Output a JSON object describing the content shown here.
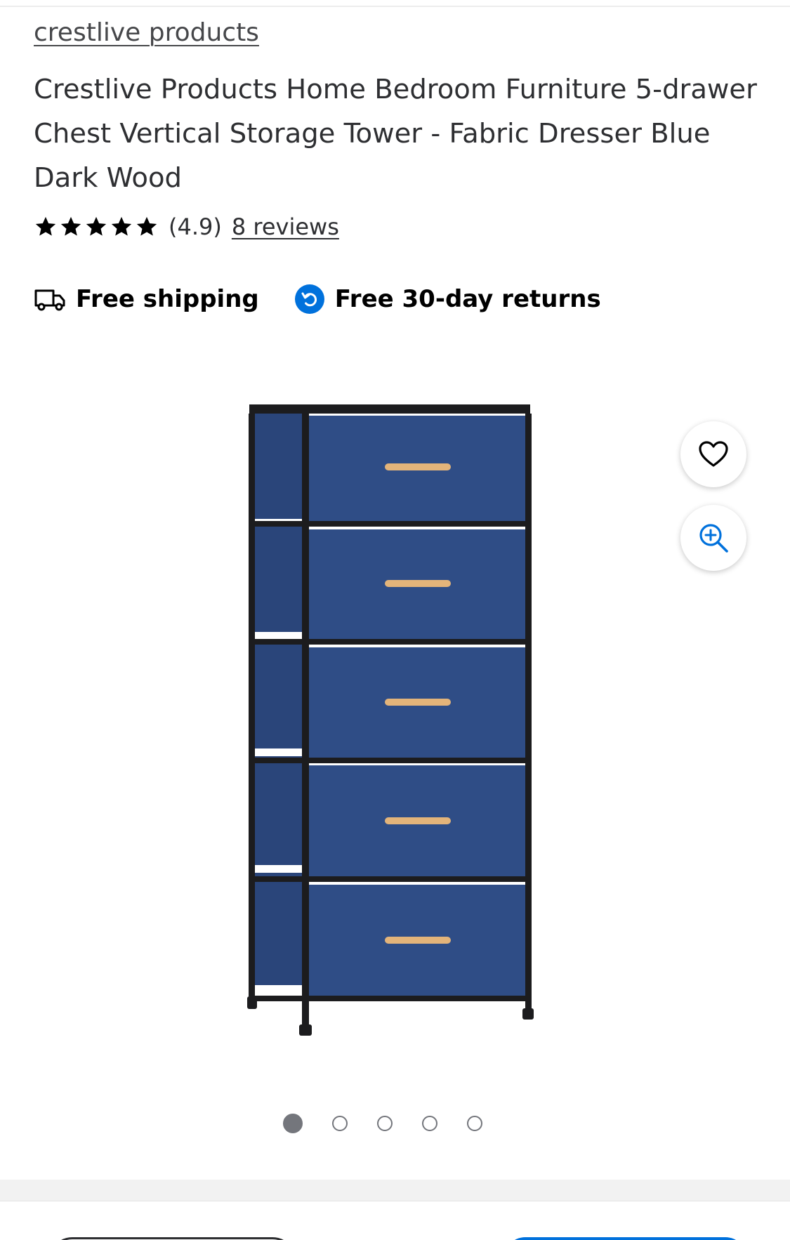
{
  "product": {
    "brand": "crestlive products",
    "title": "Crestlive Products Home Bedroom Furniture 5-drawer Chest Vertical Storage Tower - Fabric Dresser Blue Dark Wood",
    "rating_stars": 5,
    "rating_text": "(4.9)",
    "reviews_text": "8 reviews"
  },
  "badges": {
    "shipping": {
      "icon": "truck-icon",
      "label": "Free shipping"
    },
    "returns": {
      "icon": "returns-icon",
      "label": "Free 30-day returns",
      "color": "#0071dc"
    }
  },
  "image_actions": {
    "favorite_icon": "heart-icon",
    "zoom_icon": "zoom-in-icon",
    "zoom_color": "#0071dc"
  },
  "carousel": {
    "total": 5,
    "active_index": 0
  },
  "colors": {
    "text": "#2e2f32",
    "accent": "#0071dc",
    "dot": "#74767c",
    "drawer_fabric": "#2f4d86",
    "handle": "#e3b47a"
  }
}
